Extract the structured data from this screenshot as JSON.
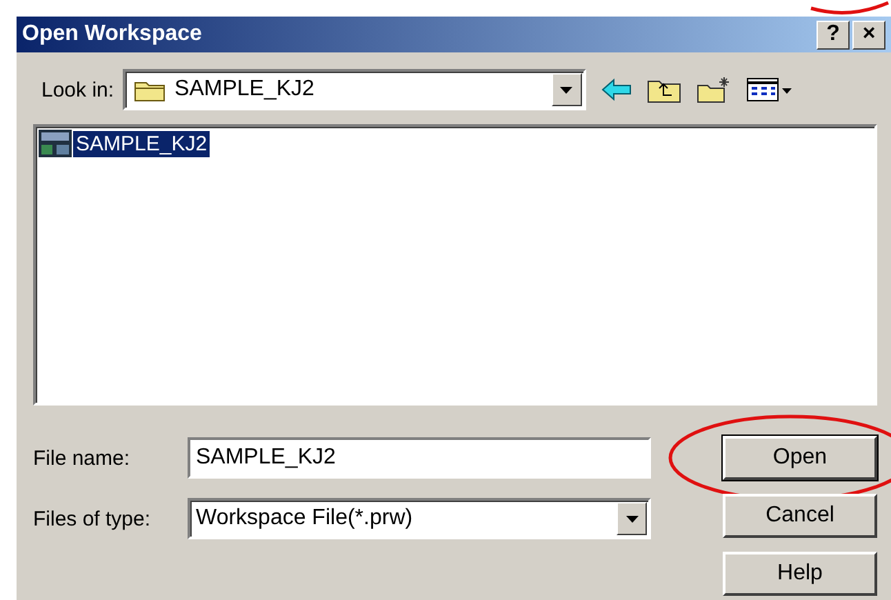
{
  "window": {
    "title": "Open Workspace",
    "help_button": "?",
    "close_button": "×"
  },
  "look_in": {
    "label": "Look in:",
    "value": "SAMPLE_KJ2"
  },
  "files": [
    {
      "name": "SAMPLE_KJ2",
      "selected": true
    }
  ],
  "file_name": {
    "label": "File name:",
    "value": "SAMPLE_KJ2"
  },
  "file_type": {
    "label": "Files of type:",
    "value": "Workspace File(*.prw)"
  },
  "buttons": [
    {
      "label": "Open",
      "default": true,
      "circled": true
    },
    {
      "label": "Cancel",
      "default": false,
      "circled": false
    },
    {
      "label": "Help",
      "default": false,
      "circled": false
    }
  ]
}
